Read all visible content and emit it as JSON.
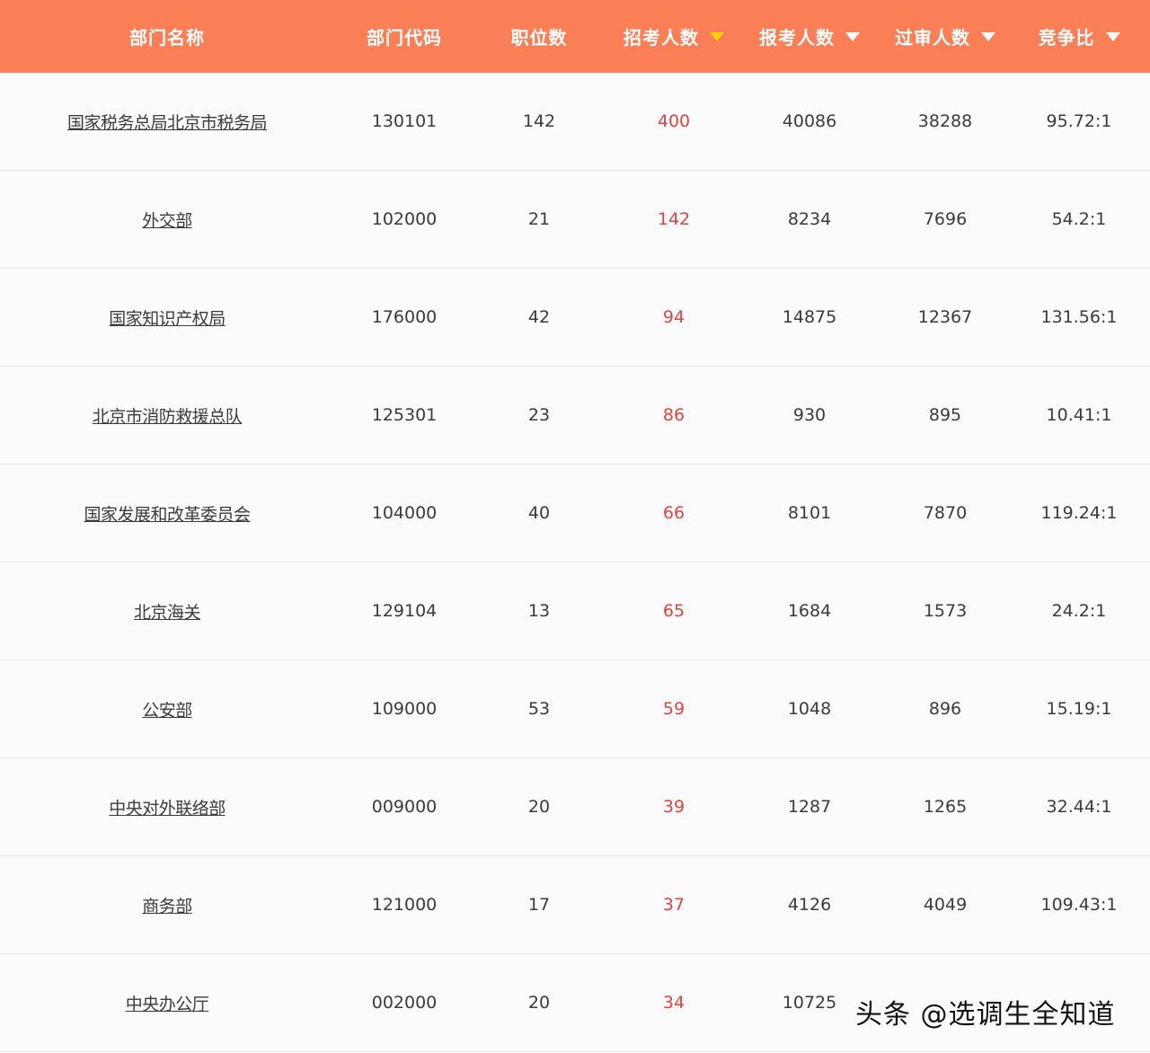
{
  "header": {
    "columns": [
      "部门名称",
      "部门代码",
      "职位数",
      "招考人数",
      "报考人数",
      "过审人数",
      "竞争比"
    ]
  },
  "rows": [
    {
      "name": "国家税务总局北京市税务局",
      "code": "130101",
      "positions": "142",
      "recruit": "400",
      "applicants": "40086",
      "approved": "38288",
      "ratio": "95.72:1"
    },
    {
      "name": "外交部",
      "code": "102000",
      "positions": "21",
      "recruit": "142",
      "applicants": "8234",
      "approved": "7696",
      "ratio": "54.2:1"
    },
    {
      "name": "国家知识产权局",
      "code": "176000",
      "positions": "42",
      "recruit": "94",
      "applicants": "14875",
      "approved": "12367",
      "ratio": "131.56:1"
    },
    {
      "name": "北京市消防救援总队",
      "code": "125301",
      "positions": "23",
      "recruit": "86",
      "applicants": "930",
      "approved": "895",
      "ratio": "10.41:1"
    },
    {
      "name": "国家发展和改革委员会",
      "code": "104000",
      "positions": "40",
      "recruit": "66",
      "applicants": "8101",
      "approved": "7870",
      "ratio": "119.24:1"
    },
    {
      "name": "北京海关",
      "code": "129104",
      "positions": "13",
      "recruit": "65",
      "applicants": "1684",
      "approved": "1573",
      "ratio": "24.2:1"
    },
    {
      "name": "公安部",
      "code": "109000",
      "positions": "53",
      "recruit": "59",
      "applicants": "1048",
      "approved": "896",
      "ratio": "15.19:1"
    },
    {
      "name": "中央对外联络部",
      "code": "009000",
      "positions": "20",
      "recruit": "39",
      "applicants": "1287",
      "approved": "1265",
      "ratio": "32.44:1"
    },
    {
      "name": "商务部",
      "code": "121000",
      "positions": "17",
      "recruit": "37",
      "applicants": "4126",
      "approved": "4049",
      "ratio": "109.43:1"
    },
    {
      "name": "中央办公厅",
      "code": "002000",
      "positions": "20",
      "recruit": "34",
      "applicants": "10725",
      "approved": "",
      "ratio": ""
    }
  ],
  "watermark": "头条 @选调生全知道",
  "colors": {
    "header_bg": "#fb7f56",
    "active_sort_arrow": "#ffd400",
    "highlight_text": "#e0443a"
  },
  "icons": {
    "sort_arrow": "caret-down-icon"
  }
}
